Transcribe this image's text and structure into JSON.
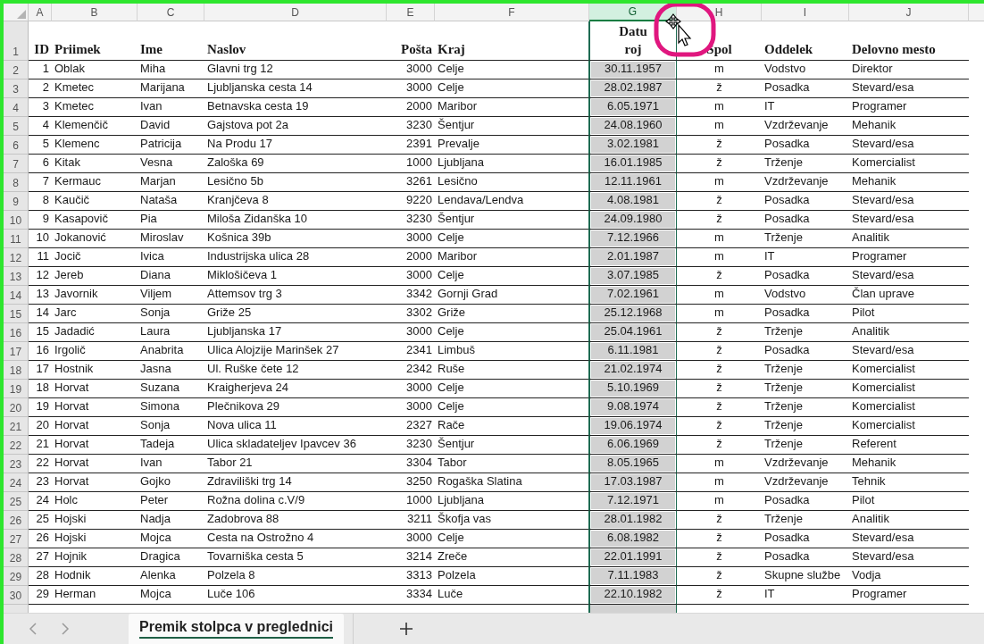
{
  "columns": [
    {
      "letter": "A",
      "heading": [
        "ID"
      ],
      "kind": "number",
      "selected": false
    },
    {
      "letter": "B",
      "heading": [
        "Priimek"
      ],
      "kind": "text",
      "selected": false
    },
    {
      "letter": "C",
      "heading": [
        "Ime"
      ],
      "kind": "text",
      "selected": false
    },
    {
      "letter": "D",
      "heading": [
        "Naslov"
      ],
      "kind": "text",
      "selected": false
    },
    {
      "letter": "E",
      "heading": [
        "Pošta"
      ],
      "kind": "number",
      "selected": false
    },
    {
      "letter": "F",
      "heading": [
        "Kraj"
      ],
      "kind": "text",
      "selected": false
    },
    {
      "letter": "G",
      "heading": [
        "Datu",
        "roj"
      ],
      "kind": "center",
      "selected": true
    },
    {
      "letter": "H",
      "heading": [
        "Spol"
      ],
      "kind": "center",
      "selected": false
    },
    {
      "letter": "I",
      "heading": [
        "Oddelek"
      ],
      "kind": "text",
      "selected": false
    },
    {
      "letter": "J",
      "heading": [
        "Delovno mesto"
      ],
      "kind": "text",
      "selected": false
    }
  ],
  "header_row_number": "1",
  "rows": [
    {
      "number": "2",
      "cells": [
        "1",
        "Oblak",
        "Miha",
        "Glavni trg 12",
        "3000",
        "Celje",
        "30.11.1957",
        "m",
        "Vodstvo",
        "Direktor"
      ]
    },
    {
      "number": "3",
      "cells": [
        "2",
        "Kmetec",
        "Marijana",
        "Ljubljanska cesta 14",
        "3000",
        "Celje",
        "28.02.1987",
        "ž",
        "Posadka",
        "Stevard/esa"
      ]
    },
    {
      "number": "4",
      "cells": [
        "3",
        "Kmetec",
        "Ivan",
        "Betnavska cesta 19",
        "2000",
        "Maribor",
        "6.05.1971",
        "m",
        "IT",
        "Programer"
      ]
    },
    {
      "number": "5",
      "cells": [
        "4",
        "Klemenčič",
        "David",
        "Gajstova pot 2a",
        "3230",
        "Šentjur",
        "24.08.1960",
        "m",
        "Vzdrževanje",
        "Mehanik"
      ]
    },
    {
      "number": "6",
      "cells": [
        "5",
        "Klemenc",
        "Patricija",
        "Na Produ 17",
        "2391",
        "Prevalje",
        "3.02.1981",
        "ž",
        "Posadka",
        "Stevard/esa"
      ]
    },
    {
      "number": "7",
      "cells": [
        "6",
        "Kitak",
        "Vesna",
        "Zaloška 69",
        "1000",
        "Ljubljana",
        "16.01.1985",
        "ž",
        "Trženje",
        "Komercialist"
      ]
    },
    {
      "number": "8",
      "cells": [
        "7",
        "Kermauc",
        "Marjan",
        "Lesično 5b",
        "3261",
        "Lesično",
        "12.11.1961",
        "m",
        "Vzdrževanje",
        "Mehanik"
      ]
    },
    {
      "number": "9",
      "cells": [
        "8",
        "Kaučič",
        "Nataša",
        "Kranjčeva 8",
        "9220",
        "Lendava/Lendva",
        "4.08.1981",
        "ž",
        "Posadka",
        "Stevard/esa"
      ]
    },
    {
      "number": "10",
      "cells": [
        "9",
        "Kasapovič",
        "Pia",
        "Miloša Zidanška 10",
        "3230",
        "Šentjur",
        "24.09.1980",
        "ž",
        "Posadka",
        "Stevard/esa"
      ]
    },
    {
      "number": "11",
      "cells": [
        "10",
        "Jokanović",
        "Miroslav",
        "Košnica 39b",
        "3000",
        "Celje",
        "7.12.1966",
        "m",
        "Trženje",
        "Analitik"
      ]
    },
    {
      "number": "12",
      "cells": [
        "11",
        "Jocič",
        "Ivica",
        "Industrijska ulica 28",
        "2000",
        "Maribor",
        "2.01.1987",
        "m",
        "IT",
        "Programer"
      ]
    },
    {
      "number": "13",
      "cells": [
        "12",
        "Jereb",
        "Diana",
        "Miklošičeva 1",
        "3000",
        "Celje",
        "3.07.1985",
        "ž",
        "Posadka",
        "Stevard/esa"
      ]
    },
    {
      "number": "14",
      "cells": [
        "13",
        "Javornik",
        "Viljem",
        "Attemsov trg 3",
        "3342",
        "Gornji Grad",
        "7.02.1961",
        "m",
        "Vodstvo",
        "Član uprave"
      ]
    },
    {
      "number": "15",
      "cells": [
        "14",
        "Jarc",
        "Sonja",
        "Griže 25",
        "3302",
        "Griže",
        "25.12.1968",
        "m",
        "Posadka",
        "Pilot"
      ]
    },
    {
      "number": "16",
      "cells": [
        "15",
        "Jadadić",
        "Laura",
        "Ljubljanska 17",
        "3000",
        "Celje",
        "25.04.1961",
        "ž",
        "Trženje",
        "Analitik"
      ]
    },
    {
      "number": "17",
      "cells": [
        "16",
        "Irgolič",
        "Anabrita",
        "Ulica Alojzije Marinšek 27",
        "2341",
        "Limbuš",
        "6.11.1981",
        "ž",
        "Posadka",
        "Stevard/esa"
      ]
    },
    {
      "number": "18",
      "cells": [
        "17",
        "Hostnik",
        "Jasna",
        "Ul. Ruške čete 12",
        "2342",
        "Ruše",
        "21.02.1974",
        "ž",
        "Trženje",
        "Komercialist"
      ]
    },
    {
      "number": "19",
      "cells": [
        "18",
        "Horvat",
        "Suzana",
        "Kraigherjeva 24",
        "3000",
        "Celje",
        "5.10.1969",
        "ž",
        "Trženje",
        "Komercialist"
      ]
    },
    {
      "number": "20",
      "cells": [
        "19",
        "Horvat",
        "Simona",
        "Plečnikova 29",
        "3000",
        "Celje",
        "9.08.1974",
        "ž",
        "Trženje",
        "Komercialist"
      ]
    },
    {
      "number": "21",
      "cells": [
        "20",
        "Horvat",
        "Sonja",
        "Nova ulica 11",
        "2327",
        "Rače",
        "19.06.1974",
        "ž",
        "Trženje",
        "Komercialist"
      ]
    },
    {
      "number": "22",
      "cells": [
        "21",
        "Horvat",
        "Tadeja",
        "Ulica skladateljev Ipavcev 36",
        "3230",
        "Šentjur",
        "6.06.1969",
        "ž",
        "Trženje",
        "Referent"
      ]
    },
    {
      "number": "23",
      "cells": [
        "22",
        "Horvat",
        "Ivan",
        "Tabor 21",
        "3304",
        "Tabor",
        "8.05.1965",
        "m",
        "Vzdrževanje",
        "Mehanik"
      ]
    },
    {
      "number": "24",
      "cells": [
        "23",
        "Horvat",
        "Gojko",
        "Zdraviliški trg 14",
        "3250",
        "Rogaška Slatina",
        "17.03.1987",
        "m",
        "Vzdrževanje",
        "Tehnik"
      ]
    },
    {
      "number": "25",
      "cells": [
        "24",
        "Holc",
        "Peter",
        "Rožna dolina c.V/9",
        "1000",
        "Ljubljana",
        "7.12.1971",
        "m",
        "Posadka",
        "Pilot"
      ]
    },
    {
      "number": "26",
      "cells": [
        "25",
        "Hojski",
        "Nadja",
        "Zadobrova 88",
        "3211",
        "Škofja vas",
        "28.01.1982",
        "ž",
        "Trženje",
        "Analitik"
      ]
    },
    {
      "number": "27",
      "cells": [
        "26",
        "Hojski",
        "Mojca",
        "Cesta na Ostrožno 4",
        "3000",
        "Celje",
        "6.08.1982",
        "ž",
        "Posadka",
        "Stevard/esa"
      ]
    },
    {
      "number": "28",
      "cells": [
        "27",
        "Hojnik",
        "Dragica",
        "Tovarniška cesta 5",
        "3214",
        "Zreče",
        "22.01.1991",
        "ž",
        "Posadka",
        "Stevard/esa"
      ]
    },
    {
      "number": "29",
      "cells": [
        "28",
        "Hodnik",
        "Alenka",
        "Polzela 8",
        "3313",
        "Polzela",
        "7.11.1983",
        "ž",
        "Skupne službe",
        "Vodja"
      ]
    },
    {
      "number": "30",
      "cells": [
        "29",
        "Herman",
        "Mojca",
        "Luče 106",
        "3334",
        "Luče",
        "22.10.1982",
        "ž",
        "IT",
        "Programer"
      ]
    }
  ],
  "sheet_tabs": [
    {
      "label": "Premik stolpca v preglednici",
      "selected": true
    }
  ]
}
